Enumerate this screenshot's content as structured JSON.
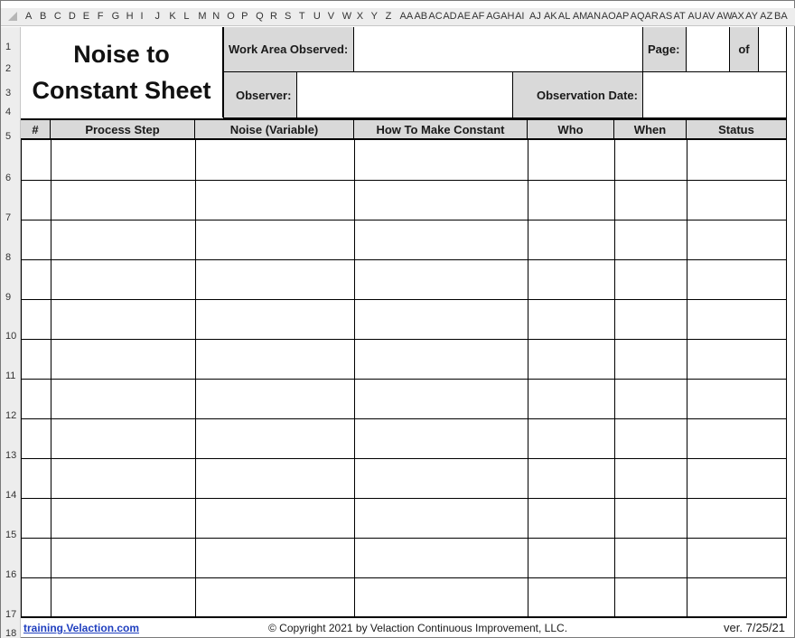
{
  "columns": [
    "A",
    "B",
    "C",
    "D",
    "E",
    "F",
    "G",
    "H",
    "I",
    "J",
    "K",
    "L",
    "M",
    "N",
    "O",
    "P",
    "Q",
    "R",
    "S",
    "T",
    "U",
    "V",
    "W",
    "X",
    "Y",
    "Z",
    "AA",
    "AB",
    "AC",
    "AD",
    "AE",
    "AF",
    "AG",
    "AH",
    "AI",
    "AJ",
    "AK",
    "AL",
    "AM",
    "AN",
    "AO",
    "AP",
    "AQ",
    "AR",
    "AS",
    "AT",
    "AU",
    "AV",
    "AW",
    "AX",
    "AY",
    "AZ",
    "BA"
  ],
  "rows": [
    "1",
    "2",
    "3",
    "4",
    "5",
    "6",
    "7",
    "8",
    "9",
    "10",
    "11",
    "12",
    "13",
    "14",
    "15",
    "16",
    "17",
    "18"
  ],
  "title": {
    "line1": "Noise to",
    "line2": "Constant Sheet"
  },
  "header_fields": {
    "work_area_label": "Work Area Observed:",
    "page_label": "Page:",
    "of_label": "of",
    "observer_label": "Observer:",
    "observation_date_label": "Observation Date:"
  },
  "table": {
    "columns": [
      "#",
      "Process Step",
      "Noise (Variable)",
      "How To Make Constant",
      "Who",
      "When",
      "Status"
    ]
  },
  "footer": {
    "link": "training.Velaction.com",
    "copyright": "© Copyright 2021 by Velaction Continuous Improvement, LLC.",
    "version": "ver. 7/25/21"
  }
}
